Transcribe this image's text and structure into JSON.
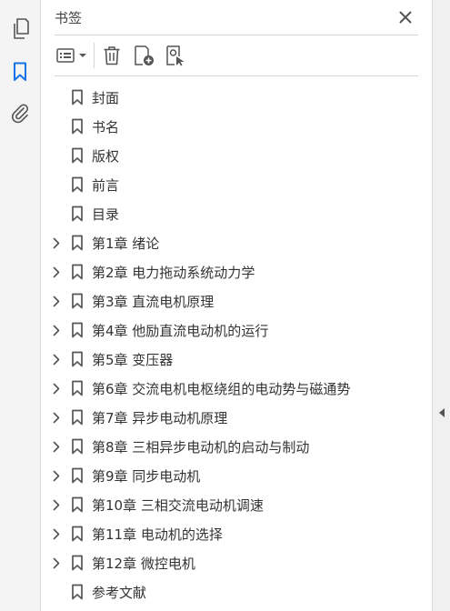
{
  "panel": {
    "title": "书签"
  },
  "rail": {
    "items": [
      {
        "icon": "pages-icon"
      },
      {
        "icon": "bookmark-icon",
        "active": true
      },
      {
        "icon": "paperclip-icon"
      }
    ]
  },
  "toolbar": {
    "buttons": [
      "options-menu",
      "delete-bookmark",
      "new-bookmark",
      "new-bookmark-from-structure"
    ]
  },
  "bookmarks": [
    {
      "label": "封面",
      "expandable": false
    },
    {
      "label": "书名",
      "expandable": false
    },
    {
      "label": "版权",
      "expandable": false
    },
    {
      "label": "前言",
      "expandable": false
    },
    {
      "label": "目录",
      "expandable": false
    },
    {
      "label": "第1章  绪论",
      "expandable": true
    },
    {
      "label": "第2章  电力拖动系统动力学",
      "expandable": true
    },
    {
      "label": "第3章  直流电机原理",
      "expandable": true
    },
    {
      "label": "第4章  他励直流电动机的运行",
      "expandable": true
    },
    {
      "label": "第5章  变压器",
      "expandable": true
    },
    {
      "label": "第6章  交流电机电枢绕组的电动势与磁通势",
      "expandable": true
    },
    {
      "label": "第7章  异步电动机原理",
      "expandable": true
    },
    {
      "label": "第8章  三相异步电动机的启动与制动",
      "expandable": true
    },
    {
      "label": "第9章  同步电动机",
      "expandable": true
    },
    {
      "label": "第10章  三相交流电动机调速",
      "expandable": true
    },
    {
      "label": "第11章  电动机的选择",
      "expandable": true
    },
    {
      "label": "第12章  微控电机",
      "expandable": true
    },
    {
      "label": "参考文献",
      "expandable": false
    }
  ],
  "colors": {
    "accent": "#1473e6",
    "icon": "#555555",
    "text": "#333333"
  }
}
